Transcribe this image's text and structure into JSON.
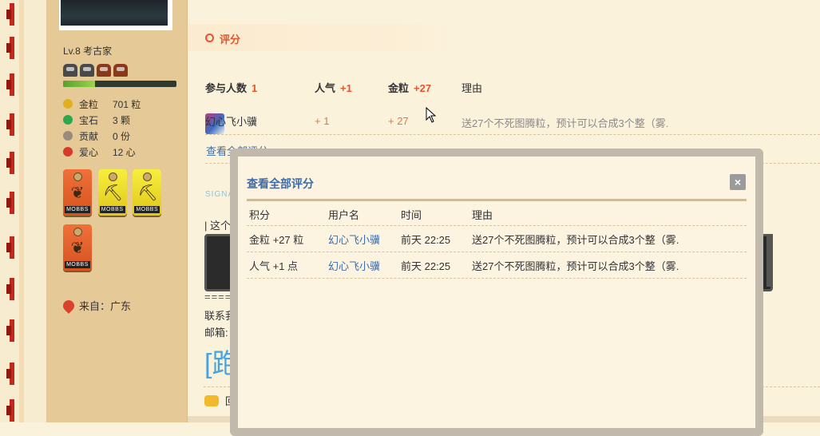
{
  "profile": {
    "level": "Lv.8 考古家",
    "xp_fraction": 0.28,
    "stats": [
      {
        "icon": "gold-icon",
        "label": "金粒",
        "value": "701 粒",
        "color": "#e0b020"
      },
      {
        "icon": "gem-icon",
        "label": "宝石",
        "value": "3 颗",
        "color": "#2ea84a"
      },
      {
        "icon": "contribution-icon",
        "label": "贡献",
        "value": "0 份",
        "color": "#9a8a7a"
      },
      {
        "icon": "heart-icon",
        "label": "爱心",
        "value": "12 心",
        "color": "#d83a2a"
      }
    ],
    "badges": [
      {
        "color": "orange",
        "caption": "MOBBS"
      },
      {
        "color": "yellow",
        "caption": "MOBBS"
      },
      {
        "color": "yellow",
        "caption": "MOBBS"
      },
      {
        "color": "orange",
        "caption": "MOBBS"
      }
    ],
    "from": "来自：广东"
  },
  "rating": {
    "section_title": "评分",
    "headers": {
      "participants_label": "参与人数",
      "participants_count": "1",
      "popularity_label": "人气",
      "popularity_value": "+1",
      "gold_label": "金粒",
      "gold_value": "+27",
      "reason_label": "理由"
    },
    "row": {
      "user": "幻心飞小骥",
      "popularity": "+ 1",
      "gold": "+ 27",
      "reason": "送27个不死图腾粒，预计可以合成3个整（雾."
    },
    "view_all": "查看全部评分"
  },
  "post": {
    "signature_label": "SIGNAT",
    "line1": "| 这个局",
    "separator": "=====",
    "contact": "联系我:",
    "mail": "邮箱: d",
    "big_text": "[跑",
    "reply": "回复"
  },
  "modal": {
    "title": "查看全部评分",
    "close_glyph": "×",
    "columns": [
      "积分",
      "用户名",
      "时间",
      "理由"
    ],
    "rows": [
      {
        "score": "金粒 +27 粒",
        "user": "幻心飞小骥",
        "time": "前天 22:25",
        "reason": "送27个不死图腾粒，预计可以合成3个整（雾."
      },
      {
        "score": "人气 +1 点",
        "user": "幻心飞小骥",
        "time": "前天 22:25",
        "reason": "送27个不死图腾粒，预计可以合成3个整（雾."
      }
    ]
  }
}
